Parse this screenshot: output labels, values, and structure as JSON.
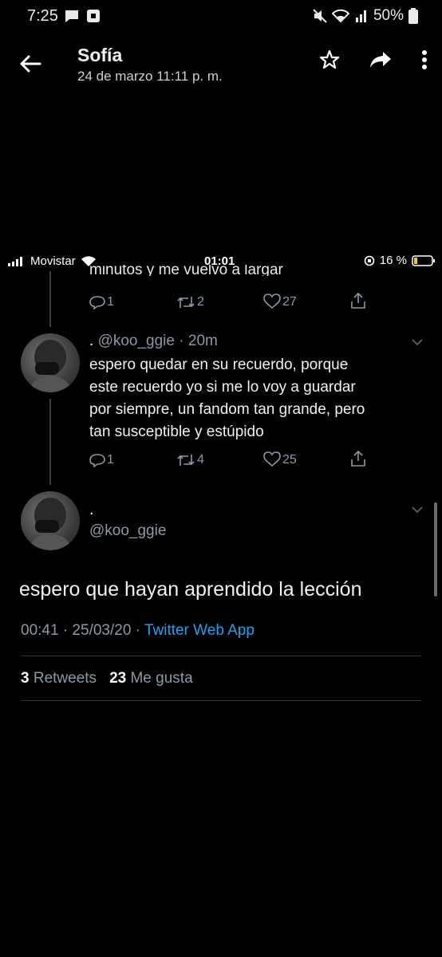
{
  "android_status": {
    "time": "7:25",
    "battery": "50%"
  },
  "header": {
    "sender": "Sofía",
    "date": "24 de marzo 11:11 p. m."
  },
  "ios_status": {
    "carrier": "Movistar",
    "time": "01:01",
    "battery": "16 %"
  },
  "clipped_reply": {
    "text": "minutos y me vuelvo a largar",
    "replies": "1",
    "retweets": "2",
    "likes": "27"
  },
  "reply_tweet": {
    "name": ".",
    "handle": "@koo_ggie",
    "age": "20m",
    "text_lines": [
      "espero quedar en su recuerdo, porque",
      "este recuerdo yo si me lo voy a guardar",
      "por siempre, un fandom tan grande, pero",
      "tan susceptible y estúpido"
    ],
    "replies": "1",
    "retweets": "4",
    "likes": "25"
  },
  "main_tweet": {
    "name": ".",
    "handle": "@koo_ggie",
    "text": "espero que hayan aprendido la lección",
    "timestamp": "00:41 · 25/03/20 · ",
    "source": "Twitter Web App",
    "retweets_count": "3",
    "retweets_label": "Retweets",
    "likes_count": "23",
    "likes_label": "Me gusta"
  },
  "icons": [
    "back-arrow-icon",
    "star-icon",
    "share-icon",
    "more-vert-icon",
    "reply-icon",
    "retweet-icon",
    "like-icon",
    "share-tweet-icon",
    "chevron-down-icon"
  ]
}
